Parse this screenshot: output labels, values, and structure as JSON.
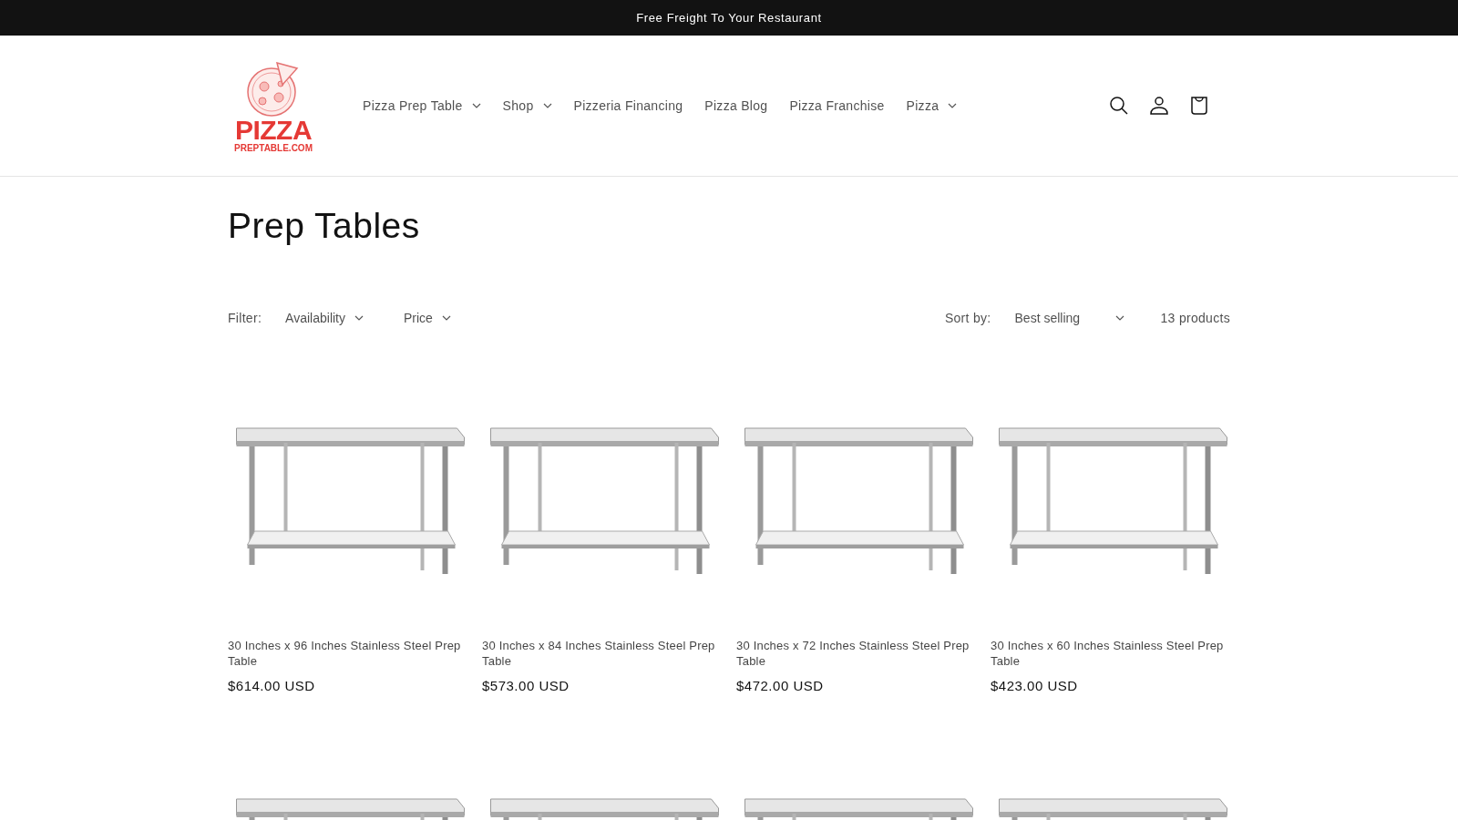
{
  "announcement": "Free Freight To Your Restaurant",
  "header": {
    "logo": {
      "word": "PIZZA",
      "domain": "PREPTABLE.COM"
    },
    "nav": [
      {
        "label": "Pizza Prep Table",
        "dropdown": true
      },
      {
        "label": "Shop",
        "dropdown": true
      },
      {
        "label": "Pizzeria Financing",
        "dropdown": false
      },
      {
        "label": "Pizza Blog",
        "dropdown": false
      },
      {
        "label": "Pizza Franchise",
        "dropdown": false
      },
      {
        "label": "Pizza",
        "dropdown": true
      }
    ]
  },
  "collection": {
    "title": "Prep Tables",
    "filter_label": "Filter:",
    "filters": [
      "Availability",
      "Price"
    ],
    "sort_label": "Sort by:",
    "sort_value": "Best selling",
    "count": "13 products"
  },
  "products": [
    {
      "kind": "table-photo",
      "title": "30 Inches x 96 Inches Stainless Steel Prep Table",
      "price": "$614.00 USD"
    },
    {
      "kind": "table-photo",
      "title": "30 Inches x 84 Inches Stainless Steel Prep Table",
      "price": "$573.00 USD"
    },
    {
      "kind": "table-photo",
      "title": "30 Inches x 72 Inches Stainless Steel Prep Table",
      "price": "$472.00 USD"
    },
    {
      "kind": "table-photo",
      "title": "30 Inches x 60 Inches Stainless Steel Prep Table",
      "price": "$423.00 USD"
    },
    {
      "kind": "table-photo"
    },
    {
      "kind": "table-photo"
    },
    {
      "kind": "table-photo"
    },
    {
      "kind": "table-photo"
    }
  ]
}
